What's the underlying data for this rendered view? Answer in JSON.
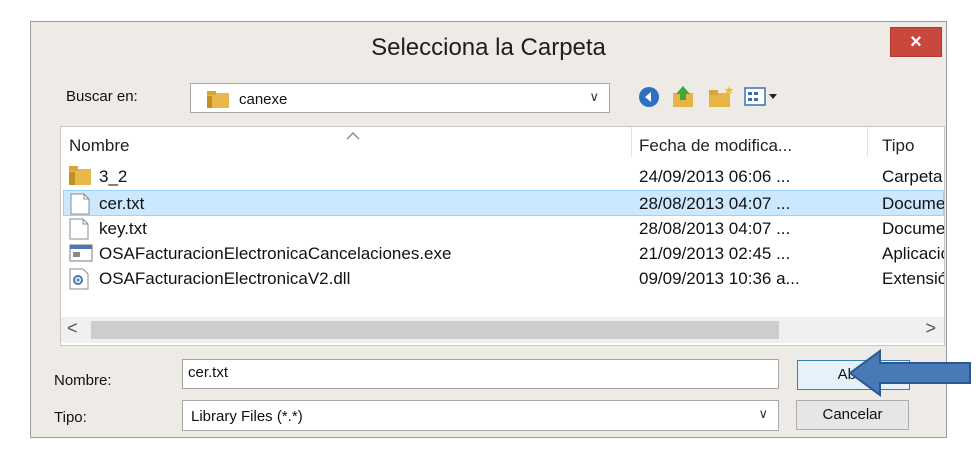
{
  "dialog": {
    "title": "Selecciona la Carpeta",
    "close_label": "×"
  },
  "lookin": {
    "label": "Buscar en:",
    "value": "canexe"
  },
  "columns": {
    "name": "Nombre",
    "date": "Fecha de modifica...",
    "type": "Tipo"
  },
  "files": [
    {
      "name": "3_2",
      "date": "24/09/2013 06:06 ...",
      "type": "Carpeta",
      "icon": "folder-icon"
    },
    {
      "name": "cer.txt",
      "date": "28/08/2013 04:07 ...",
      "type": "Docume",
      "icon": "text-file-icon",
      "selected": true
    },
    {
      "name": "key.txt",
      "date": "28/08/2013 04:07 ...",
      "type": "Docume",
      "icon": "text-file-icon"
    },
    {
      "name": "OSAFacturacionElectronicaCancelaciones.exe",
      "date": "21/09/2013 02:45 ...",
      "type": "Aplicació",
      "icon": "application-icon"
    },
    {
      "name": "OSAFacturacionElectronicaV2.dll",
      "date": "09/09/2013 10:36 a...",
      "type": "Extensión",
      "icon": "dll-file-icon"
    }
  ],
  "scroll": {
    "left": "<",
    "right": ">"
  },
  "filename": {
    "label": "Nombre:",
    "value": "cer.txt"
  },
  "filetype": {
    "label": "Tipo:",
    "value": "Library Files (*.*)"
  },
  "buttons": {
    "open": "Abrir",
    "cancel": "Cancelar"
  },
  "colors": {
    "selection": "#cce8ff",
    "close": "#c9483d",
    "arrow": "#4a79b8"
  }
}
